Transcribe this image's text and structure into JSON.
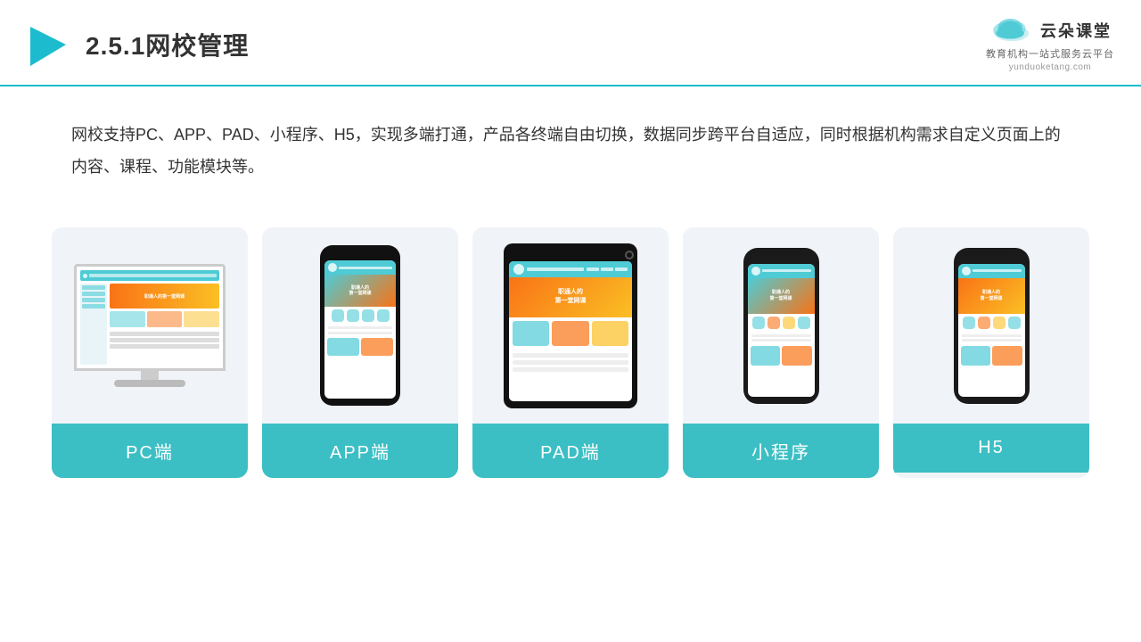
{
  "header": {
    "title": "2.5.1网校管理",
    "logo_cn": "云朵课堂",
    "logo_url": "yunduoketang.com",
    "logo_sub": "教育机构一站\n式服务云平台"
  },
  "description": {
    "text": "网校支持PC、APP、PAD、小程序、H5，实现多端打通，产品各终端自由切换，数据同步跨平台自适应，同时根据机构需求自定义页面上的内容、课程、功能模块等。"
  },
  "cards": [
    {
      "label": "PC端",
      "type": "pc"
    },
    {
      "label": "APP端",
      "type": "phone"
    },
    {
      "label": "PAD端",
      "type": "tablet"
    },
    {
      "label": "小程序",
      "type": "phone-mini"
    },
    {
      "label": "H5",
      "type": "phone-mini"
    }
  ],
  "colors": {
    "teal": "#3bbfc4",
    "accent_orange": "#f97316",
    "accent_yellow": "#fbbf24",
    "card_bg": "#f0f4f9",
    "header_border": "#1cbcce"
  }
}
